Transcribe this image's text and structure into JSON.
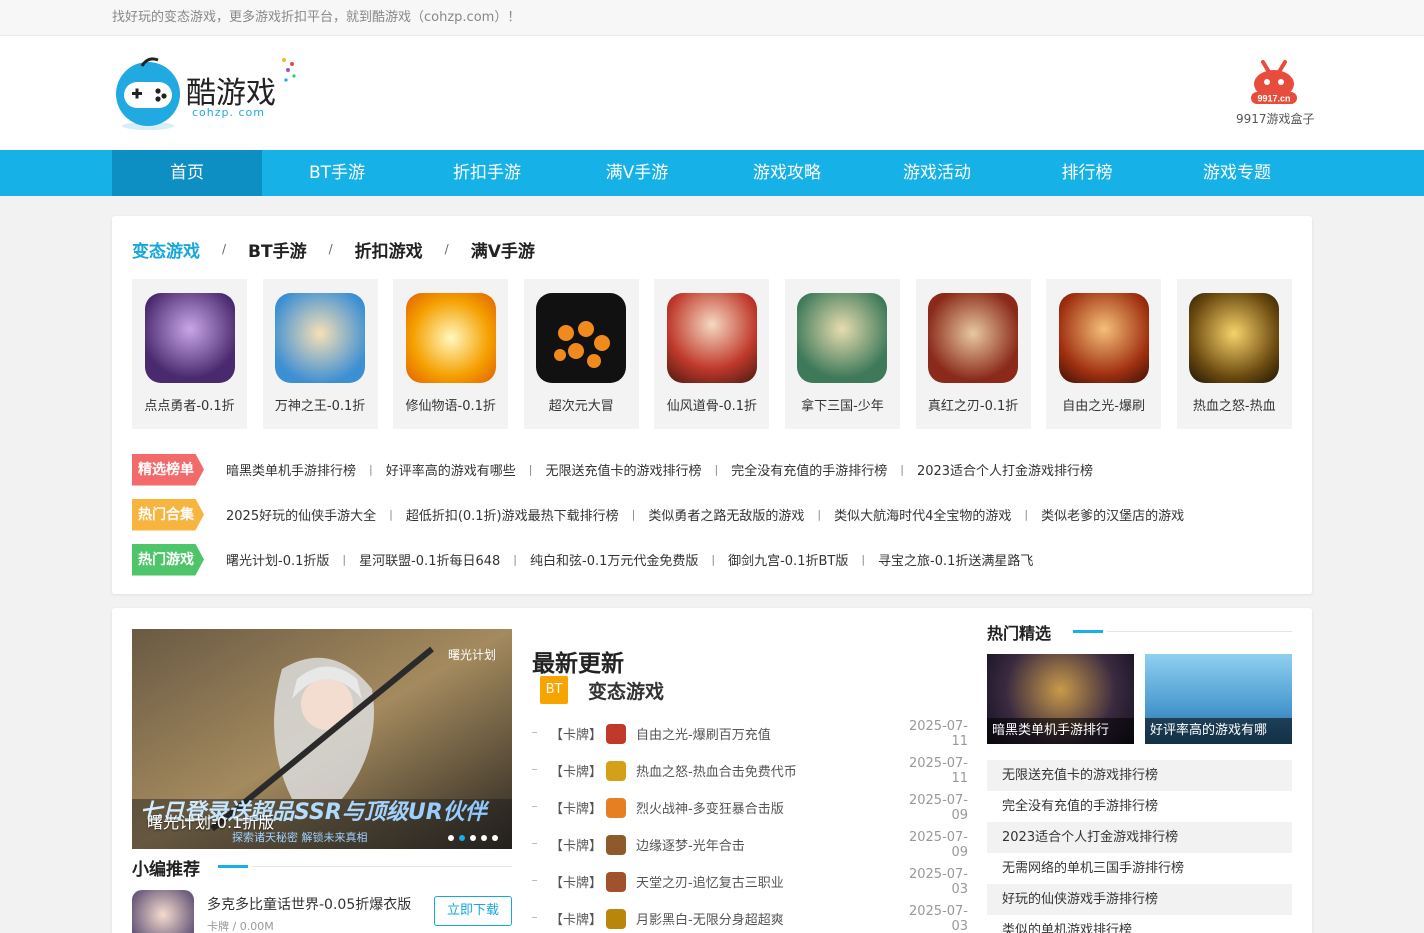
{
  "topbar": {
    "text": "找好玩的变态游戏，更多游戏折扣平台，就到酷游戏（cohzp.com）！"
  },
  "logo": {
    "name": "酷游戏",
    "domain": "cohzp. com"
  },
  "appbox": {
    "label": "9917游戏盒子",
    "badge": "9917.cn"
  },
  "nav": [
    "首页",
    "BT手游",
    "折扣手游",
    "满V手游",
    "游戏攻略",
    "游戏活动",
    "排行榜",
    "游戏专题"
  ],
  "category_tabs": [
    "变态游戏",
    "BT手游",
    "折扣游戏",
    "满V手游"
  ],
  "tab_separator": "/",
  "games": [
    {
      "name": "点点勇者-0.1折",
      "icon": "game-icon-purple-warrior"
    },
    {
      "name": "万神之王-0.1折",
      "icon": "game-icon-chibi-hero"
    },
    {
      "name": "修仙物语-0.1折",
      "icon": "game-icon-golden-star"
    },
    {
      "name": "超次元大冒",
      "icon": "game-icon-dragon-balls"
    },
    {
      "name": "仙风道骨-0.1折",
      "icon": "game-icon-monk"
    },
    {
      "name": "拿下三国-少年",
      "icon": "game-icon-three-kingdoms"
    },
    {
      "name": "真红之刃-0.1折",
      "icon": "game-icon-mu"
    },
    {
      "name": "自由之光-爆刷",
      "icon": "game-icon-warrior-sword"
    },
    {
      "name": "热血之怒-热血",
      "icon": "game-icon-free-gold"
    }
  ],
  "tag_rows": [
    {
      "badge": "精选榜单",
      "color": "#f36a6a",
      "links": [
        "暗黑类单机手游排行榜",
        "好评率高的游戏有哪些",
        "无限送充值卡的游戏排行榜",
        "完全没有充值的手游排行榜",
        "2023适合个人打金游戏排行榜"
      ]
    },
    {
      "badge": "热门合集",
      "color": "#f7b43f",
      "links": [
        "2025好玩的仙侠手游大全",
        "超低折扣(0.1折)游戏最热下载排行榜",
        "类似勇者之路无敌版的游戏",
        "类似大航海时代4全宝物的游戏",
        "类似老爹的汉堡店的游戏"
      ]
    },
    {
      "badge": "热门游戏",
      "color": "#4fc56a",
      "links": [
        "曙光计划-0.1折版",
        "星河联盟-0.1折每日648",
        "纯白和弦-0.1万元代金免费版",
        "御剑九宫-0.1折BT版",
        "寻宝之旅-0.1折送满星路飞"
      ]
    }
  ],
  "tag_separator": "|",
  "banner": {
    "title": "曙光计划-0.1折版",
    "art_text": "七日登录送超品SSR与顶级UR伙伴",
    "art_sub": "探索诸天秘密 解锁未来真相",
    "logo_text": "曙光计划",
    "slides": 5,
    "active_slide": 2
  },
  "editor_pick": {
    "title": "小编推荐",
    "item": {
      "name": "多克多比童话世界-0.05折爆衣版",
      "meta": "卡牌 / 0.00M",
      "button": "立即下载"
    }
  },
  "latest": {
    "title": "最新更新",
    "category_badge": "BT",
    "category_label": "变态游戏",
    "items": [
      {
        "cat": "【卡牌】",
        "name": "自由之光-爆刷百万充值",
        "date": "2025-07-11",
        "icon_color": "#c0392b"
      },
      {
        "cat": "【卡牌】",
        "name": "热血之怒-热血合击免费代币",
        "date": "2025-07-11",
        "icon_color": "#d4a017"
      },
      {
        "cat": "【卡牌】",
        "name": "烈火战神-多变狂暴合击版",
        "date": "2025-07-09",
        "icon_color": "#e67e22"
      },
      {
        "cat": "【卡牌】",
        "name": "边缘逐梦-光年合击",
        "date": "2025-07-09",
        "icon_color": "#8e5a2b"
      },
      {
        "cat": "【卡牌】",
        "name": "天堂之刃-追忆复古三职业",
        "date": "2025-07-03",
        "icon_color": "#a0522d"
      },
      {
        "cat": "【卡牌】",
        "name": "月影黑白-无限分身超超爽",
        "date": "2025-07-03",
        "icon_color": "#b8860b"
      }
    ]
  },
  "hot": {
    "title": "热门精选",
    "images": [
      {
        "caption": "暗黑类单机手游排行"
      },
      {
        "caption": "好评率高的游戏有哪"
      }
    ],
    "list": [
      "无限送充值卡的游戏排行榜",
      "完全没有充值的手游排行榜",
      "2023适合个人打金游戏排行榜",
      "无需网络的单机三国手游排行榜",
      "好玩的仙侠游戏手游排行榜",
      "类似的单机游戏排行榜"
    ]
  }
}
